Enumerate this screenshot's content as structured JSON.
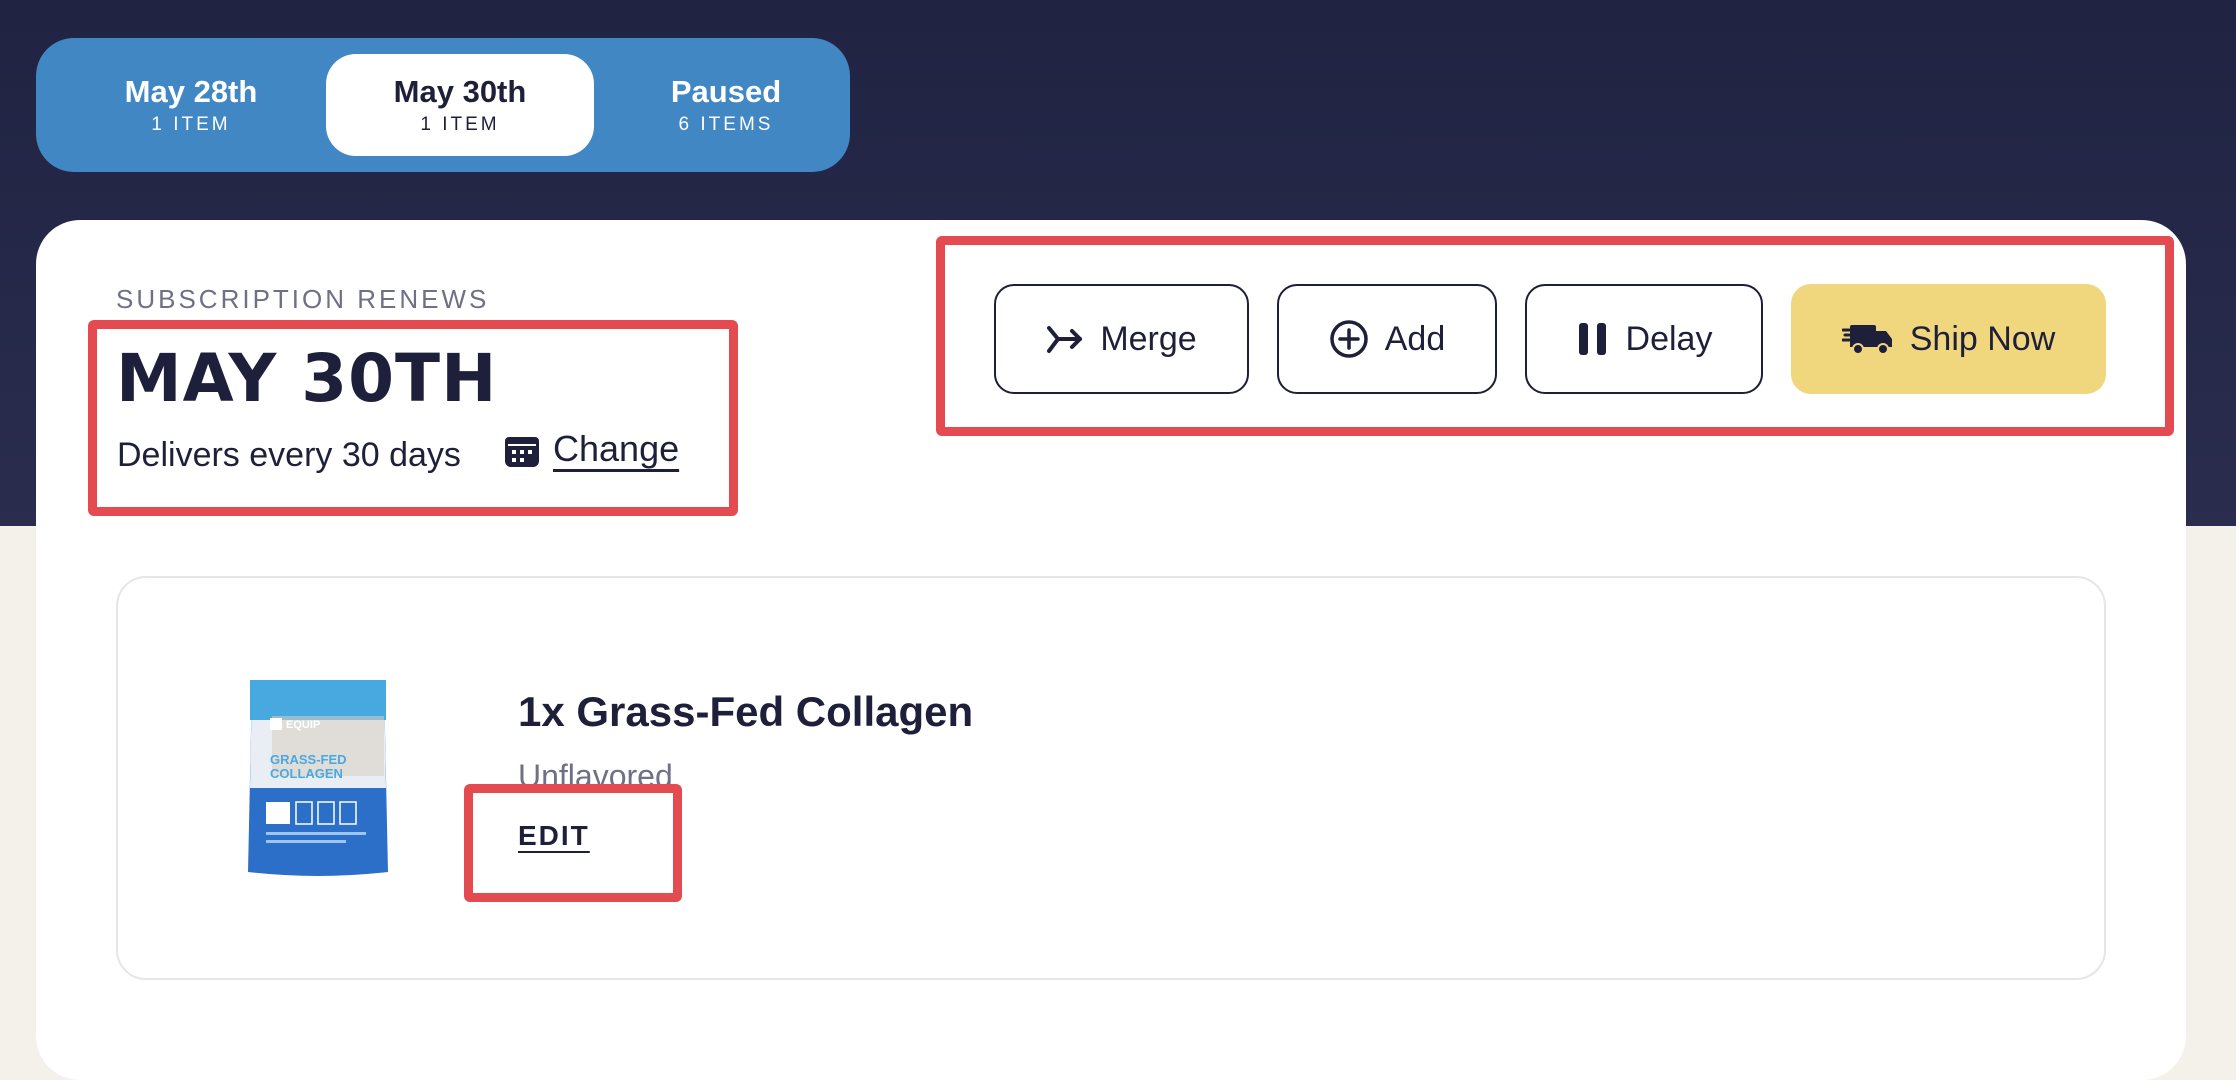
{
  "tabs": [
    {
      "name": "May 28th",
      "count": "1 ITEM",
      "active": false
    },
    {
      "name": "May 30th",
      "count": "1 ITEM",
      "active": true
    },
    {
      "name": "Paused",
      "count": "6 ITEMS",
      "active": false
    }
  ],
  "subscription": {
    "renews_label": "SUBSCRIPTION RENEWS",
    "date": "MAY 30TH",
    "frequency": "Delivers every 30 days",
    "change_label": "Change"
  },
  "actions": {
    "merge": {
      "label": "Merge",
      "icon": "merge-icon"
    },
    "add": {
      "label": "Add",
      "icon": "plus-circle-icon"
    },
    "delay": {
      "label": "Delay",
      "icon": "pause-icon"
    },
    "ship_now": {
      "label": "Ship Now",
      "icon": "truck-icon"
    }
  },
  "product": {
    "title": "1x Grass-Fed Collagen",
    "variant": "Unflavored",
    "edit_label": "EDIT",
    "package_brand": "EQUIP",
    "package_name_line1": "GRASS-FED",
    "package_name_line2": "COLLAGEN"
  },
  "colors": {
    "header_bg": "#202342",
    "tab_bar": "#4187c3",
    "ship_button": "#f0d77d",
    "highlight": "#e34b50",
    "page_bg": "#f4f1ea"
  }
}
